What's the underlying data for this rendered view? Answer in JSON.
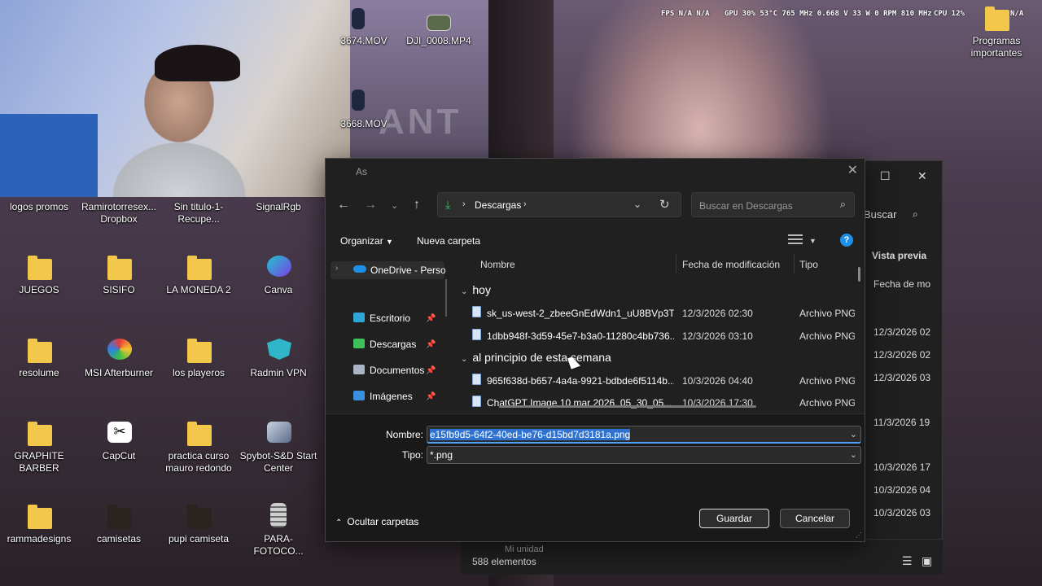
{
  "desktop_icons": [
    {
      "label": "logos promos"
    },
    {
      "label": "Ramirotorresex... Dropbox"
    },
    {
      "label": "Sin titulo-1-Recupe..."
    },
    {
      "label": "SignalRgb"
    },
    {
      "label": "JUEGOS"
    },
    {
      "label": "SISIFO"
    },
    {
      "label": "LA MONEDA 2"
    },
    {
      "label": "Canva"
    },
    {
      "label": "resolume"
    },
    {
      "label": "MSI Afterburner"
    },
    {
      "label": "los playeros"
    },
    {
      "label": "Radmin VPN"
    },
    {
      "label": "GRAPHITE BARBER"
    },
    {
      "label": "CapCut"
    },
    {
      "label": "practica curso mauro redondo"
    },
    {
      "label": "Spybot-S&D Start Center"
    },
    {
      "label": "rammadesigns"
    },
    {
      "label": "camisetas"
    },
    {
      "label": "pupi camiseta"
    },
    {
      "label": "PARA-FOTOCO..."
    },
    {
      "label": "3674.MOV"
    },
    {
      "label": "DJI_0008.MP4"
    },
    {
      "label": "3668.MOV"
    },
    {
      "label": "Programas importantes"
    }
  ],
  "overlay": {
    "fps": "FPS  N/A  N/A",
    "gpu": "GPU 30% 53°C 765 MHz 0.668 V 33 W 0 RPM 810 MHz",
    "cpu": "CPU 12%",
    "extra": "N/A"
  },
  "background_window": {
    "search_label": "Buscar",
    "preview_label": "Vista previa",
    "date_header": "Fecha de mo",
    "dates": [
      "12/3/2026 02",
      "12/3/2026 02",
      "12/3/2026 03",
      "11/3/2026 19",
      "10/3/2026 17",
      "10/3/2026 04",
      "10/3/2026 03"
    ],
    "status_count": "588 elementos",
    "drive_label": "Mi unidad"
  },
  "dialog": {
    "title": "As",
    "address": {
      "location": "Descargas"
    },
    "search_placeholder": "Buscar en Descargas",
    "toolbar": {
      "organize": "Organizar",
      "new_folder": "Nueva carpeta",
      "help": "?"
    },
    "nav": {
      "onedrive": "OneDrive - Perso",
      "items": [
        {
          "label": "Escritorio",
          "icon": "desktop-icon",
          "color": "#2fa6d8"
        },
        {
          "label": "Descargas",
          "icon": "download-icon",
          "color": "#3fbf5a"
        },
        {
          "label": "Documentos",
          "icon": "document-icon",
          "color": "#a9b4c4"
        },
        {
          "label": "Imágenes",
          "icon": "image-icon",
          "color": "#3b8fe0"
        }
      ]
    },
    "columns": {
      "name": "Nombre",
      "modified": "Fecha de modificación",
      "type": "Tipo"
    },
    "groups": [
      {
        "label": "hoy"
      },
      {
        "label": "al principio de esta semana"
      }
    ],
    "files": [
      {
        "name": "sk_us-west-2_zbeeGnEdWdn1_uU8BVp3T...",
        "date": "12/3/2026 02:30",
        "type": "Archivo PNG"
      },
      {
        "name": "1dbb948f-3d59-45e7-b3a0-11280c4bb736...",
        "date": "12/3/2026 03:10",
        "type": "Archivo PNG"
      },
      {
        "name": "965f638d-b657-4a4a-9921-bdbde6f5114b...",
        "date": "10/3/2026 04:40",
        "type": "Archivo PNG"
      },
      {
        "name": "ChatGPT Image 10 mar 2026, 05_30_05...",
        "date": "10/3/2026 17:30",
        "type": "Archivo PNG"
      }
    ],
    "form": {
      "name_label": "Nombre:",
      "name_value": "e15fb9d5-64f2-40ed-be76-d15bd7d3181a.png",
      "type_label": "Tipo:",
      "type_value": "*.png",
      "hide_folders": "Ocultar carpetas",
      "save": "Guardar",
      "cancel": "Cancelar"
    }
  }
}
